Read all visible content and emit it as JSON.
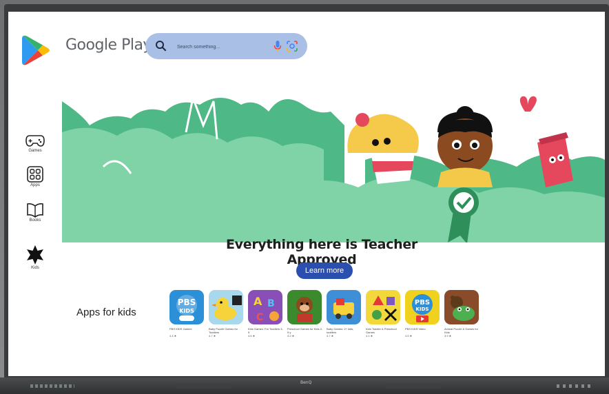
{
  "header": {
    "brand": "Google Play",
    "search_placeholder": "Search something..."
  },
  "sidebar": {
    "items": [
      {
        "label": "Games",
        "icon": "gamepad-icon"
      },
      {
        "label": "Apps",
        "icon": "apps-grid-icon"
      },
      {
        "label": "Books",
        "icon": "book-icon"
      },
      {
        "label": "Kids",
        "icon": "star-icon"
      }
    ]
  },
  "hero": {
    "title": "Everything here is Teacher Approved",
    "cta": "Learn more"
  },
  "apps_section": {
    "title": "Apps for kids",
    "apps": [
      {
        "name": "PBS KIDS Games",
        "rating": "4.4 ★",
        "icon": "pbs-kids-logo-icon",
        "color": "#2c90d8"
      },
      {
        "name": "Baby Puzzle Games for Toddlers",
        "rating": "4.7 ★",
        "icon": "rubber-duck-icon",
        "color": "#a7d8ec"
      },
      {
        "name": "Kids Games: For Toddlers 3-5",
        "rating": "4.6 ★",
        "icon": "abc-letters-icon",
        "color": "#8a4fb6"
      },
      {
        "name": "Preschool Games for Kids 2-5 y",
        "rating": "4.2 ★",
        "icon": "monkey-icon",
        "color": "#3c8a2e"
      },
      {
        "name": "Baby Games: 2+ kids, toddlers",
        "rating": "4.7 ★",
        "icon": "train-icon",
        "color": "#3e8fd6"
      },
      {
        "name": "Kids Toddler & Preschool Games",
        "rating": "4.1 ★",
        "icon": "shapes-icon",
        "color": "#f2d83a"
      },
      {
        "name": "PBS KIDS Video",
        "rating": "4.5 ★",
        "icon": "pbs-kids-video-icon",
        "color": "#f0d21e"
      },
      {
        "name": "Animal Puzzle & Games for Kids",
        "rating": "3.9 ★",
        "icon": "frog-bear-icon",
        "color": "#8a4b2a"
      }
    ]
  },
  "device": {
    "brand": "BenQ"
  },
  "colors": {
    "accent": "#2b4fae",
    "search_bg": "#aabfe6",
    "hero_green": "#4fb887"
  }
}
